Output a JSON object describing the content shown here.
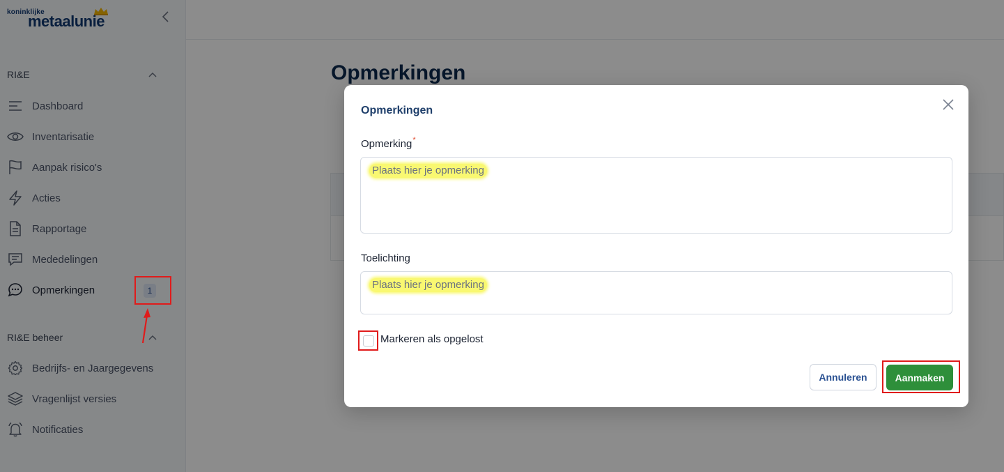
{
  "logo": {
    "small_text": "koninklijke",
    "brand": "metaalunie"
  },
  "sidebar": {
    "section1": {
      "title": "RI&E"
    },
    "section1_items": [
      {
        "label": "Dashboard",
        "icon": "dashboard-lines-icon"
      },
      {
        "label": "Inventarisatie",
        "icon": "eye-icon"
      },
      {
        "label": "Aanpak risico's",
        "icon": "flag-icon"
      },
      {
        "label": "Acties",
        "icon": "lightning-icon"
      },
      {
        "label": "Rapportage",
        "icon": "document-icon"
      },
      {
        "label": "Mededelingen",
        "icon": "chat-lines-icon"
      },
      {
        "label": "Opmerkingen",
        "icon": "chat-dots-icon",
        "badge": "1",
        "active": true
      }
    ],
    "section2": {
      "title": "RI&E beheer"
    },
    "section2_items": [
      {
        "label": "Bedrijfs- en Jaargegevens",
        "icon": "gear-icon"
      },
      {
        "label": "Vragenlijst versies",
        "icon": "layers-icon"
      },
      {
        "label": "Notificaties",
        "icon": "bell-icon"
      }
    ]
  },
  "page": {
    "title": "Opmerkingen"
  },
  "modal": {
    "title": "Opmerkingen",
    "field1": {
      "label": "Opmerking",
      "required_mark": "*",
      "placeholder": "Plaats hier je opmerking"
    },
    "field2": {
      "label": "Toelichting",
      "placeholder": "Plaats hier je opmerking"
    },
    "checkbox": {
      "label": "Markeren als opgelost",
      "checked": false
    },
    "buttons": {
      "cancel": "Annuleren",
      "create": "Aanmaken"
    }
  },
  "colors": {
    "brand_navy": "#123a72",
    "create_green": "#2e8f3a",
    "annotation_red": "#e01b1b",
    "highlight_yellow": "#f9f871"
  }
}
